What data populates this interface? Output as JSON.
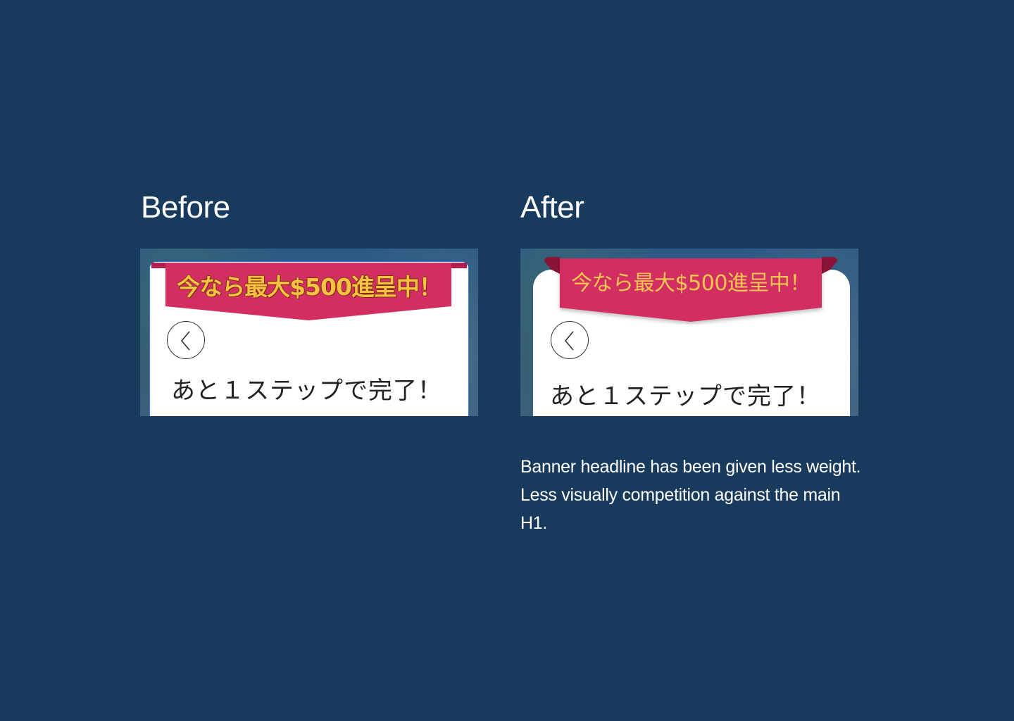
{
  "before": {
    "heading": "Before",
    "banner_text": "今なら最大$500進呈中！",
    "h1": "あと１ステップで完了！"
  },
  "after": {
    "heading": "After",
    "banner_text": "今なら最大$500進呈中！",
    "h1": "あと１ステップで完了！",
    "caption": "Banner headline has been given less weight. Less visually competition against the main H1."
  },
  "colors": {
    "page_background": "#183a5c",
    "banner_fill": "#d32e62",
    "banner_text": "#f5c242",
    "card_background": "#ffffff"
  },
  "icons": {
    "back": "chevron-left-icon"
  }
}
